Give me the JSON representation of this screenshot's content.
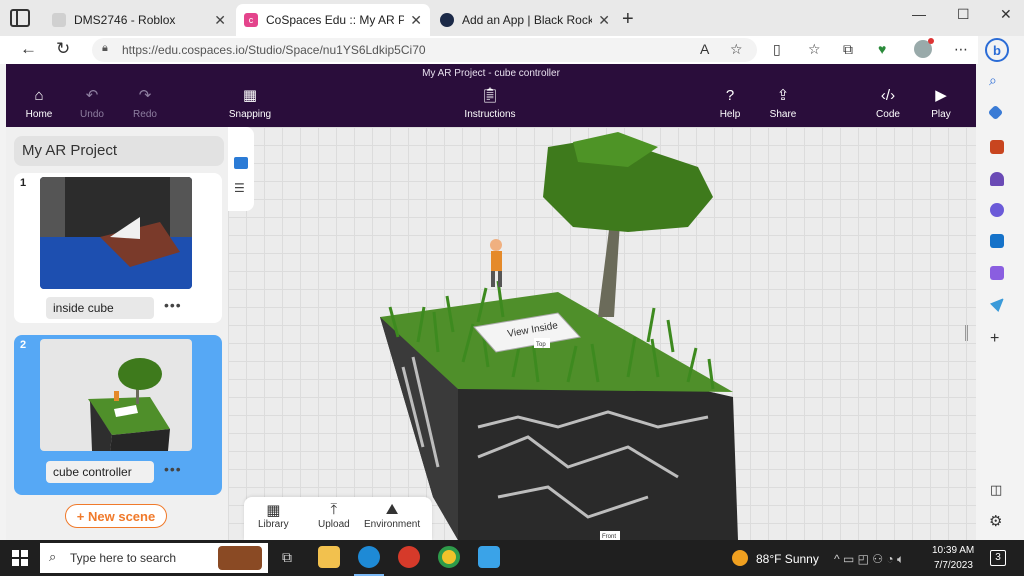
{
  "browser": {
    "tabs": [
      {
        "title": "DMS2746 - Roblox",
        "active": false
      },
      {
        "title": "CoSpaces Edu :: My AR Project",
        "active": true
      },
      {
        "title": "Add an App | Black Rocket Arcade",
        "active": false
      }
    ],
    "url": "https://edu.cospaces.io/Studio/Space/nu1YS6Ldkip5Ci70"
  },
  "header": {
    "title": "My AR Project - cube controller",
    "buttons": {
      "home": "Home",
      "undo": "Undo",
      "redo": "Redo",
      "snapping": "Snapping",
      "instructions": "Instructions",
      "help": "Help",
      "share": "Share",
      "code": "Code",
      "play": "Play"
    }
  },
  "scenes": {
    "project_title": "My AR Project",
    "items": [
      {
        "number": "1",
        "name": "inside cube",
        "selected": false
      },
      {
        "number": "2",
        "name": "cube controller",
        "selected": true
      }
    ],
    "new_scene_label": "+ New scene",
    "more_label": "•••"
  },
  "viewport": {
    "sign_text": "View Inside",
    "tag_top": "Top",
    "tag_front": "Front"
  },
  "drawer": {
    "library": "Library",
    "upload": "Upload",
    "environment": "Environment"
  },
  "taskbar": {
    "search_placeholder": "Type here to search",
    "weather": "88°F  Sunny",
    "time": "10:39 AM",
    "date": "7/7/2023",
    "notifications": "3"
  },
  "colors": {
    "header_bg": "#2a0d3b",
    "accent_orange": "#f07a2b",
    "selected_scene": "#56a8f5"
  }
}
